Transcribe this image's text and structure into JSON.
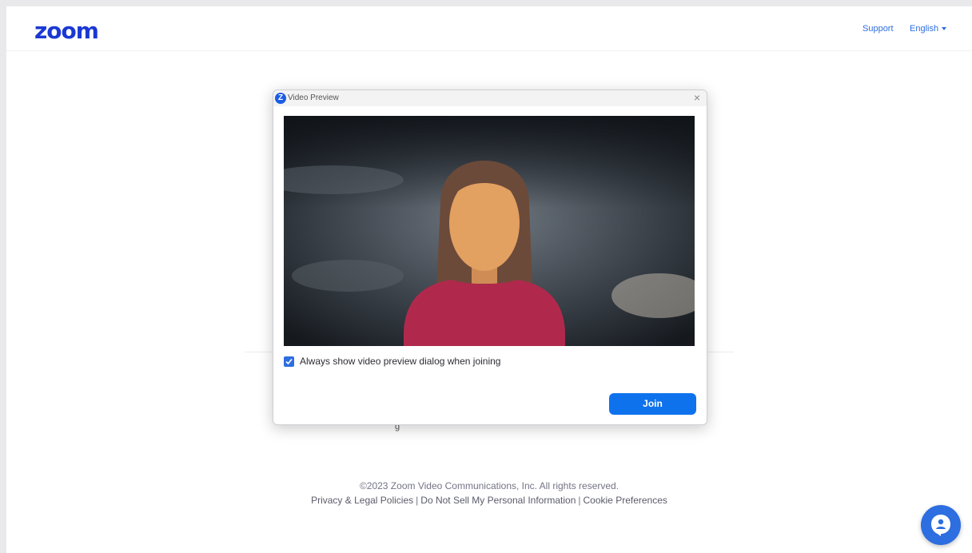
{
  "header": {
    "logo": "zoom",
    "support_label": "Support",
    "language_label": "English"
  },
  "dialog": {
    "title": "Video Preview",
    "close_symbol": "×",
    "checkbox_label": "Always show video preview dialog when joining",
    "checkbox_checked": true,
    "join_label": "Join"
  },
  "background": {
    "partial_text": "g"
  },
  "footer": {
    "copyright": "©2023 Zoom Video Communications, Inc. All rights reserved.",
    "links": [
      "Privacy & Legal Policies",
      "Do Not Sell My Personal Information",
      "Cookie Preferences"
    ]
  },
  "colors": {
    "brand": "#1a38d4",
    "link": "#2d6ee0",
    "join_button": "#0e72ed"
  },
  "icons": {
    "help": "chat-help-icon",
    "app": "zoom-app-icon",
    "close": "close-icon",
    "check": "check-icon",
    "caret": "caret-down-icon"
  }
}
